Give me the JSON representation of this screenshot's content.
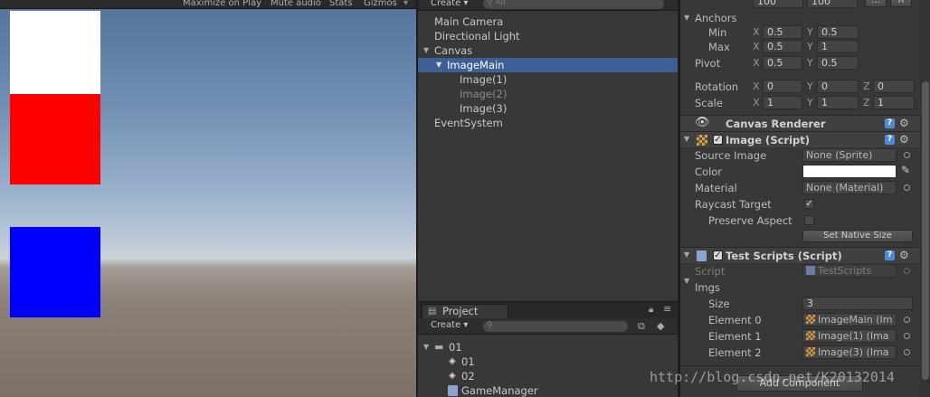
{
  "game": {
    "toolbar": {
      "maximize_on_play": "Maximize on Play",
      "mute_audio": "Mute audio",
      "stats": "Stats",
      "gizmos": "Gizmos"
    },
    "colors": {
      "white_square": "#ffffff",
      "red_square": "#ff0000",
      "blue_square": "#0000ff"
    }
  },
  "hierarchy": {
    "create_label": "Create",
    "search_placeholder": "All",
    "items": [
      "Main Camera",
      "Directional Light",
      "Canvas",
      "ImageMain",
      "Image(1)",
      "Image(2)",
      "Image(3)",
      "EventSystem"
    ]
  },
  "project": {
    "tab_label": "Project",
    "create_label": "Create",
    "items": [
      "01",
      "01",
      "02",
      "GameManager"
    ]
  },
  "inspector": {
    "size_values": [
      "100",
      "100"
    ],
    "anchors_label": "Anchors",
    "min_label": "Min",
    "max_label": "Max",
    "pivot_label": "Pivot",
    "rotation_label": "Rotation",
    "scale_label": "Scale",
    "axis_x": "X",
    "axis_y": "Y",
    "axis_z": "Z",
    "min": [
      "0.5",
      "0.5"
    ],
    "max": [
      "0.5",
      "1"
    ],
    "pivot": [
      "0.5",
      "0.5"
    ],
    "rotation": [
      "0",
      "0",
      "0"
    ],
    "scale": [
      "1",
      "1",
      "1"
    ],
    "canvas_renderer_title": "Canvas Renderer",
    "image_script": {
      "title": "Image (Script)",
      "source_image_label": "Source Image",
      "source_image_value": "None (Sprite)",
      "color_label": "Color",
      "color_value": "#ffffff",
      "material_label": "Material",
      "material_value": "None (Material)",
      "raycast_target_label": "Raycast Target",
      "preserve_aspect_label": "Preserve Aspect",
      "set_native_size_label": "Set Native Size"
    },
    "test_scripts": {
      "title": "Test Scripts (Script)",
      "script_label": "Script",
      "script_value": "TestScripts",
      "imgs_label": "Imgs",
      "size_label": "Size",
      "size_value": "3",
      "elements": [
        {
          "label": "Element 0",
          "value": "ImageMain (Im"
        },
        {
          "label": "Element 1",
          "value": "Image(1) (Ima"
        },
        {
          "label": "Element 2",
          "value": "Image(3) (Ima"
        }
      ]
    },
    "add_component_label": "Add Component"
  },
  "watermark": "http://blog.csdn.net/K20132014"
}
